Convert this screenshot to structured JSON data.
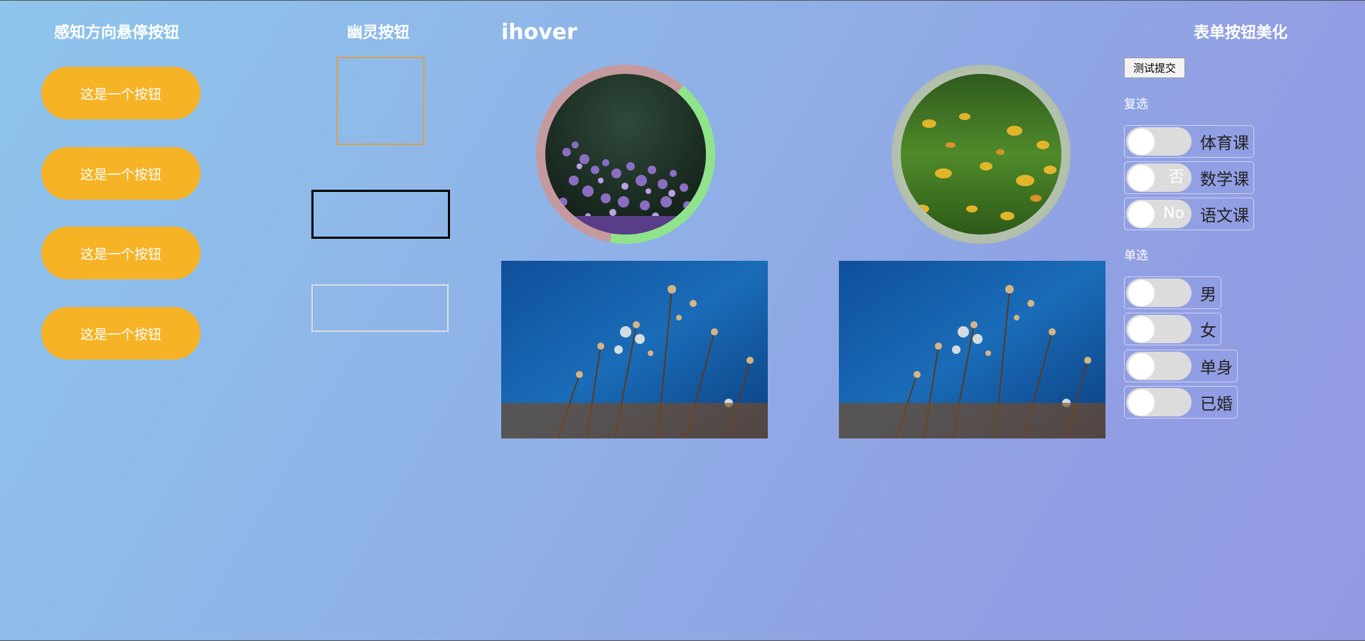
{
  "hover_section": {
    "title": "感知方向悬停按钮",
    "buttons": [
      "这是一个按钮",
      "这是一个按钮",
      "这是一个按钮",
      "这是一个按钮"
    ]
  },
  "ghost_section": {
    "title": "幽灵按钮"
  },
  "ihover_section": {
    "title": "ihover",
    "images": [
      "purple-flower-circle",
      "grass-leaves-circle",
      "bokeh-flowers-rect",
      "bokeh-flowers-rect"
    ]
  },
  "form_section": {
    "title": "表单按钮美化",
    "submit_label": "测试提交",
    "checkbox_label": "复选",
    "checkboxes": [
      {
        "label": "体育课",
        "text": ""
      },
      {
        "label": "数学课",
        "text": "否"
      },
      {
        "label": "语文课",
        "text": "No"
      }
    ],
    "radio_label": "单选",
    "radios": [
      {
        "label": "男"
      },
      {
        "label": "女"
      },
      {
        "label": "单身"
      },
      {
        "label": "已婚"
      }
    ]
  },
  "colors": {
    "button_orange": "#f7b326",
    "ring_pink": "#c49a9e",
    "ring_green": "#8fe48b"
  }
}
